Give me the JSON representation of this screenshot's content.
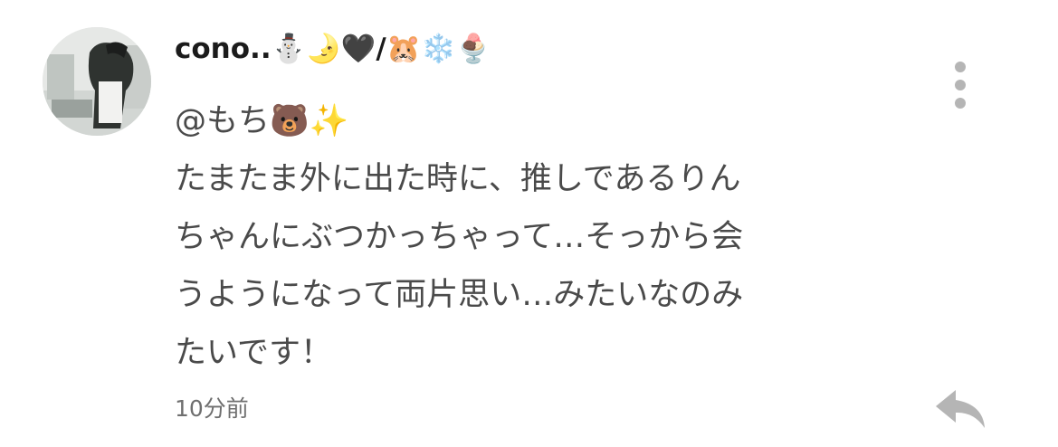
{
  "comment": {
    "username": "cono..⛄🌛🖤/🐹❄️🍨",
    "mention": "@もち🐻✨",
    "body_lines": [
      "たまたま外に出た時に、推しであるりん",
      "ちゃんにぶつかっちゃって…そっから会",
      "うようになって両片思い…みたいなのみ",
      "たいです！"
    ],
    "timestamp": "10分前"
  },
  "icons": {
    "more": "more-vertical-icon",
    "reply": "reply-arrow-icon",
    "avatar": "user-avatar-photo"
  },
  "colors": {
    "username": "#1b1b1b",
    "body_text": "#4a4a4a",
    "timestamp": "#6f6f6f",
    "icon_gray": "#b5b5b5"
  }
}
